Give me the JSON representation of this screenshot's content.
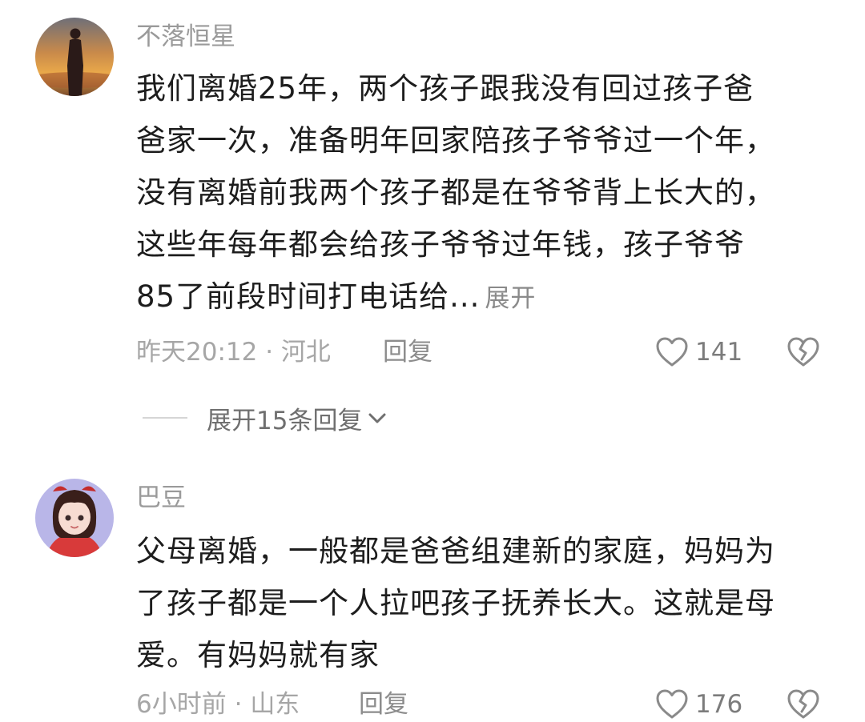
{
  "comments": [
    {
      "username": "不落恒星",
      "text_lines": [
        "我们离婚25年，两个孩子跟我没有回过孩子爸",
        "爸家一次，准备明年回家陪孩子爷爷过一个年，",
        "没有离婚前我两个孩子都是在爷爷背上长大的，",
        "这些年每年都会给孩子爷爷过年钱，孩子爷爷",
        "85了前段时间打电话给..."
      ],
      "expand_label": "展开",
      "time": "昨天20:12",
      "separator": "·",
      "location": "河北",
      "reply_label": "回复",
      "like_count": "141",
      "replies_expand_label": "展开15条回复"
    },
    {
      "username": "巴豆",
      "text_lines": [
        "父母离婚，一般都是爸爸组建新的家庭，妈妈为",
        "了孩子都是一个人拉吧孩子抚养长大。这就是母",
        "爱。有妈妈就有家"
      ],
      "time": "6小时前",
      "separator": "·",
      "location": "山东",
      "reply_label": "回复",
      "like_count": "176"
    }
  ],
  "icons": {
    "like": "heart-outline-icon",
    "dislike": "broken-heart-icon",
    "expand": "chevron-down-icon"
  },
  "colors": {
    "username": "#9a9a9a",
    "body_text": "#1d1d1d",
    "meta": "#a6a6a6",
    "icon": "#8a8a8a"
  }
}
